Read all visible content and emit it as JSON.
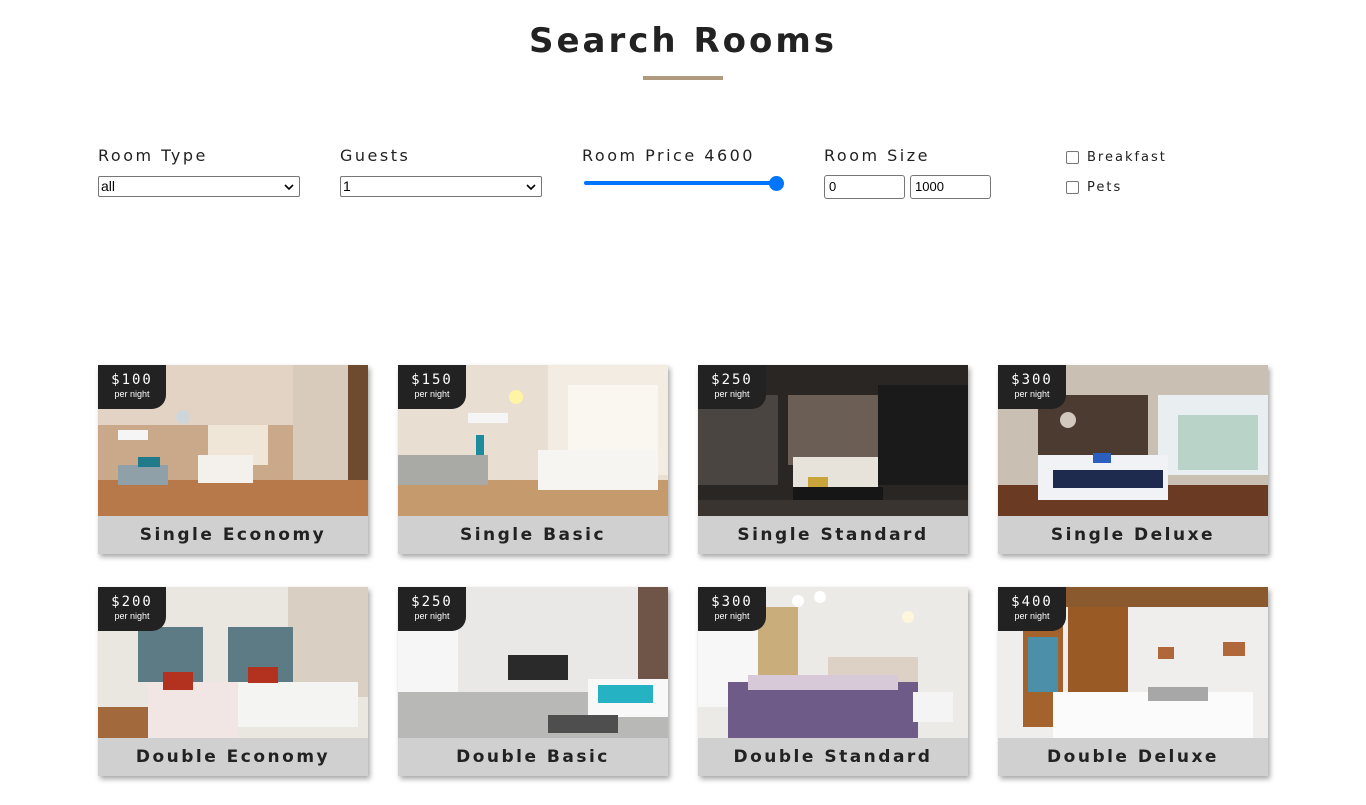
{
  "header": {
    "title": "Search Rooms"
  },
  "filters": {
    "room_type": {
      "label": "Room Type",
      "value": "all"
    },
    "guests": {
      "label": "Guests",
      "value": "1"
    },
    "price": {
      "label": "Room Price 4600",
      "value": 4600,
      "level": 1.0
    },
    "size": {
      "label": "Room Size",
      "min": "0",
      "max": "1000"
    },
    "breakfast": {
      "label": "Breakfast",
      "checked": false
    },
    "pets": {
      "label": "Pets",
      "checked": false
    }
  },
  "rooms": [
    {
      "price": "$100",
      "per": "per night",
      "name": "Single Economy",
      "scene": "warm"
    },
    {
      "price": "$150",
      "per": "per night",
      "name": "Single Basic",
      "scene": "bright"
    },
    {
      "price": "$250",
      "per": "per night",
      "name": "Single Standard",
      "scene": "dark"
    },
    {
      "price": "$300",
      "per": "per night",
      "name": "Single Deluxe",
      "scene": "navy"
    },
    {
      "price": "$200",
      "per": "per night",
      "name": "Double Economy",
      "scene": "twin"
    },
    {
      "price": "$250",
      "per": "per night",
      "name": "Double Basic",
      "scene": "grey"
    },
    {
      "price": "$300",
      "per": "per night",
      "name": "Double Standard",
      "scene": "purple"
    },
    {
      "price": "$400",
      "per": "per night",
      "name": "Double Deluxe",
      "scene": "wood"
    }
  ],
  "colors": {
    "accent": "#af9a7d",
    "slider": "#0075ff",
    "badge": "#222222",
    "caption": "#d0d0d0"
  }
}
